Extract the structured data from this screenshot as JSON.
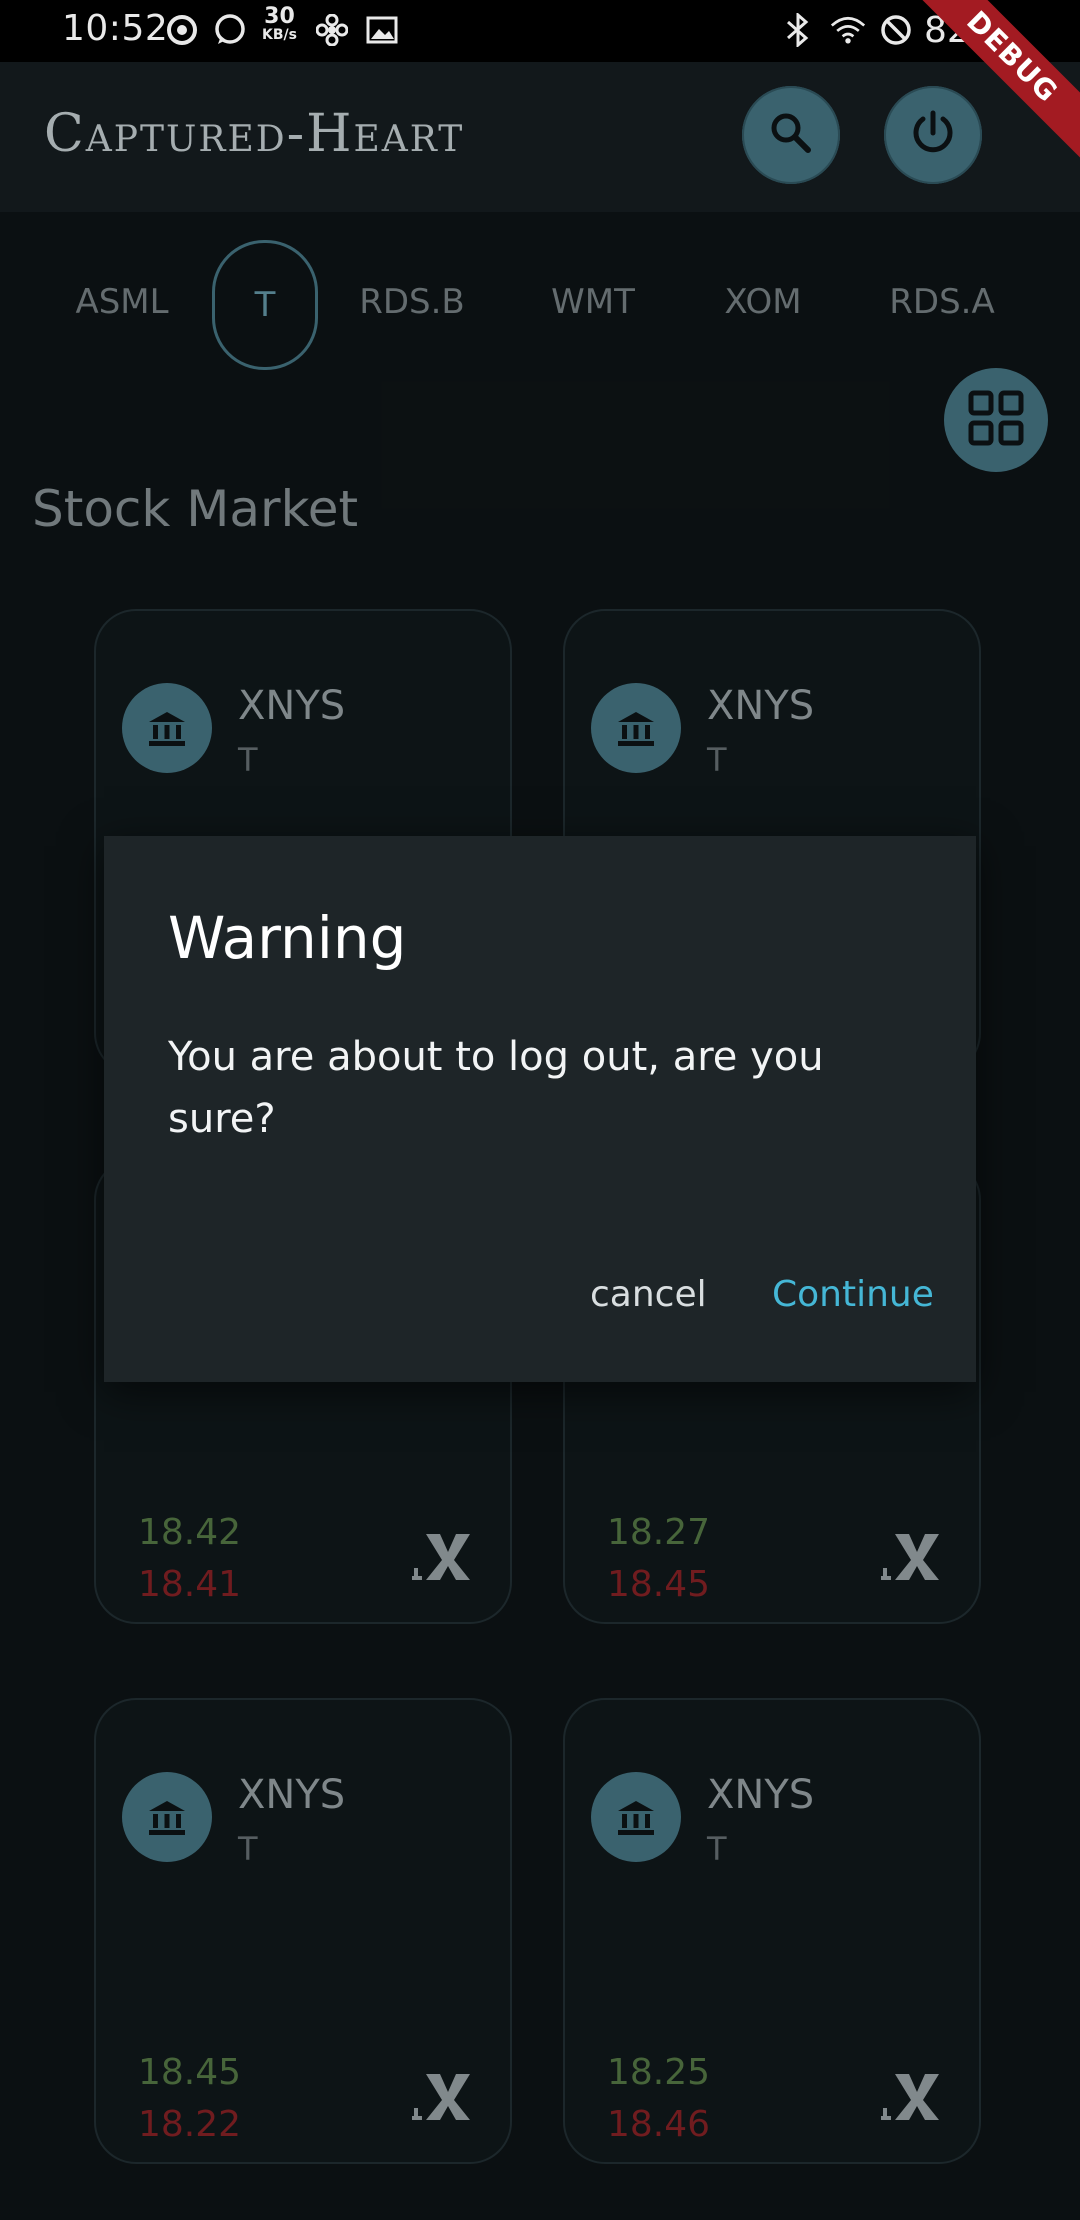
{
  "status_bar": {
    "time": "10:52",
    "net_speed": "30",
    "net_speed_unit": "KB/s",
    "battery": "82%",
    "icons": [
      "media-icon",
      "whatsapp-icon",
      "network-speed",
      "fan-icon",
      "gallery-icon",
      "bluetooth-icon",
      "wifi-icon",
      "dnd-icon",
      "battery-icon"
    ]
  },
  "debug_ribbon": "DEBUG",
  "app_bar": {
    "title": "Captured-Heart",
    "actions": [
      "search-icon",
      "power-icon"
    ]
  },
  "tabs": [
    {
      "label": "ASML",
      "active": false
    },
    {
      "label": "T",
      "active": true
    },
    {
      "label": "RDS.B",
      "active": false
    },
    {
      "label": "WMT",
      "active": false
    },
    {
      "label": "XOM",
      "active": false
    },
    {
      "label": "RDS.A",
      "active": false
    }
  ],
  "section_title": "Stock Market",
  "cards": [
    {
      "exchange": "XNYS",
      "ticker": "T",
      "bid": "",
      "ask": ""
    },
    {
      "exchange": "XNYS",
      "ticker": "T",
      "bid": "",
      "ask": ""
    },
    {
      "exchange": "",
      "ticker": "",
      "bid": "18.42",
      "ask": "18.41"
    },
    {
      "exchange": "",
      "ticker": "",
      "bid": "18.27",
      "ask": "18.45"
    },
    {
      "exchange": "XNYS",
      "ticker": "T",
      "bid": "18.45",
      "ask": "18.22"
    },
    {
      "exchange": "XNYS",
      "ticker": "T",
      "bid": "18.25",
      "ask": "18.46"
    }
  ],
  "dialog": {
    "title": "Warning",
    "message": "You are about to log out, are you sure?",
    "cancel_label": "cancel",
    "continue_label": "Continue"
  },
  "colors": {
    "accent": "#3f6b78",
    "bid": "#4e6e3f",
    "ask": "#7a1f22",
    "continue": "#45b7d6"
  }
}
